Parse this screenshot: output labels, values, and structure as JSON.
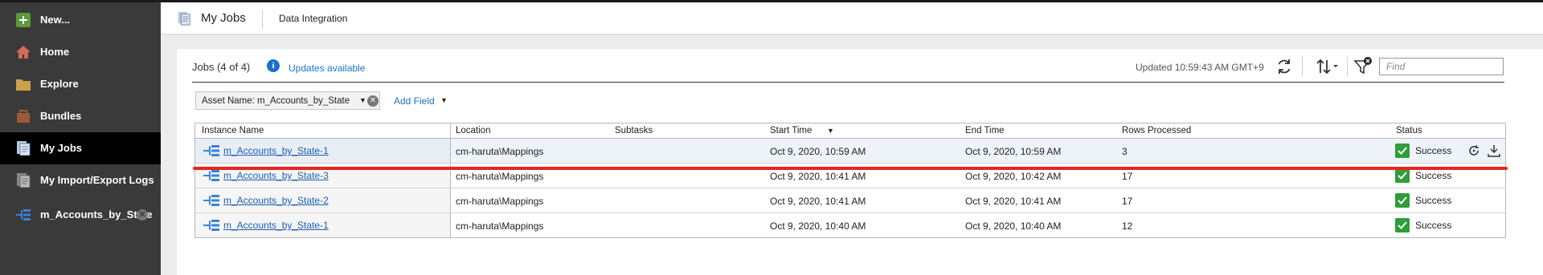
{
  "sidebar": {
    "items": [
      {
        "label": "New...",
        "icon": "plus-icon"
      },
      {
        "label": "Home",
        "icon": "home-icon"
      },
      {
        "label": "Explore",
        "icon": "folder-icon"
      },
      {
        "label": "Bundles",
        "icon": "bundle-icon"
      },
      {
        "label": "My Jobs",
        "icon": "jobs-icon",
        "active": true
      },
      {
        "label": "My Import/Export Logs",
        "icon": "logs-icon"
      },
      {
        "label": "m_Accounts_by_State",
        "icon": "mapping-icon",
        "closable": true
      }
    ]
  },
  "header": {
    "title": "My Jobs",
    "subtitle": "Data Integration"
  },
  "jobs": {
    "count_label": "Jobs (4 of 4)",
    "updates_label": "Updates available",
    "updated_label": "Updated 10:59:43 AM GMT+9",
    "find_placeholder": "Find"
  },
  "filter": {
    "chip_label": "Asset Name: m_Accounts_by_State",
    "add_field_label": "Add Field"
  },
  "table": {
    "columns": [
      "Instance Name",
      "Location",
      "Subtasks",
      "Start Time",
      "End Time",
      "Rows Processed",
      "Status"
    ],
    "sort_indicator": "▼",
    "rows": [
      {
        "name": "m_Accounts_by_State-1",
        "location": "cm-haruta\\Mappings",
        "subtasks": "",
        "start": "Oct 9, 2020, 10:59 AM",
        "end": "Oct 9, 2020, 10:59 AM",
        "rows": "3",
        "status": "Success"
      },
      {
        "name": "m_Accounts_by_State-3",
        "location": "cm-haruta\\Mappings",
        "subtasks": "",
        "start": "Oct 9, 2020, 10:41 AM",
        "end": "Oct 9, 2020, 10:42 AM",
        "rows": "17",
        "status": "Success"
      },
      {
        "name": "m_Accounts_by_State-2",
        "location": "cm-haruta\\Mappings",
        "subtasks": "",
        "start": "Oct 9, 2020, 10:41 AM",
        "end": "Oct 9, 2020, 10:41 AM",
        "rows": "17",
        "status": "Success"
      },
      {
        "name": "m_Accounts_by_State-1",
        "location": "cm-haruta\\Mappings",
        "subtasks": "",
        "start": "Oct 9, 2020, 10:40 AM",
        "end": "Oct 9, 2020, 10:40 AM",
        "rows": "12",
        "status": "Success"
      }
    ]
  },
  "colors": {
    "accent": "#1a73c8",
    "success": "#2e9d3a",
    "highlight": "#e6261f",
    "sidebar_bg": "#3a3a3a"
  }
}
